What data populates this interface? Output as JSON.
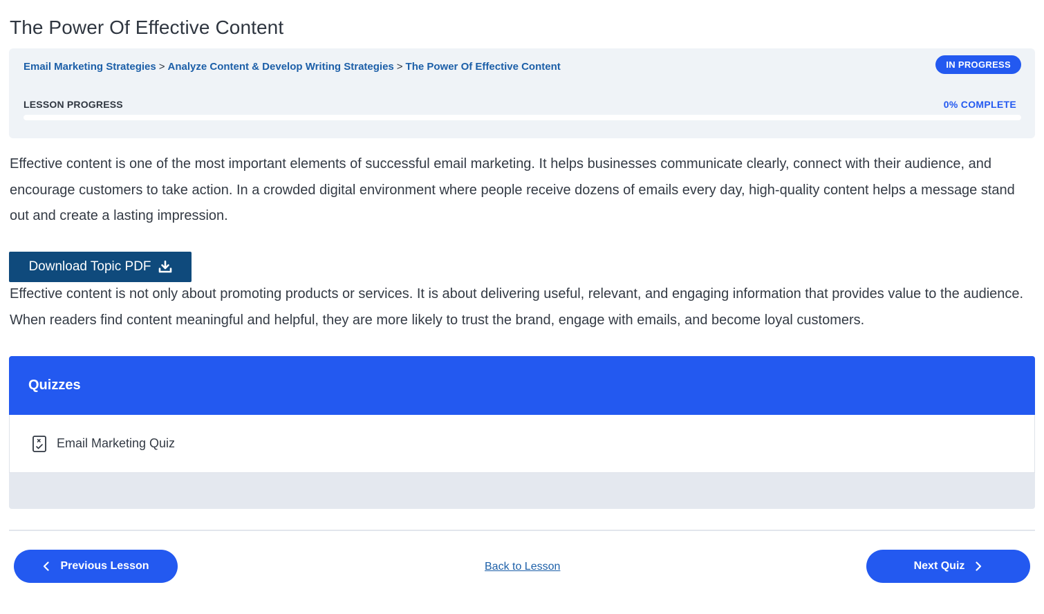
{
  "page": {
    "title": "The Power Of Effective Content"
  },
  "breadcrumb": {
    "items": [
      "Email Marketing Strategies",
      "Analyze Content & Develop Writing Strategies",
      "The Power Of Effective Content"
    ],
    "separator": ">"
  },
  "status": {
    "label": "IN PROGRESS"
  },
  "progress": {
    "label": "LESSON PROGRESS",
    "percent_text": "0% COMPLETE",
    "value": 0
  },
  "content": {
    "paragraph1": "Effective content is one of the most important elements of successful email marketing. It helps businesses communicate clearly, connect with their audience, and encourage customers to take action. In a crowded digital environment where people receive dozens of emails every day, high-quality content helps a message stand out and create a lasting impression.",
    "download_label": "Download Topic PDF",
    "paragraph2": "Effective content is not only about promoting products or services. It is about delivering useful, relevant, and engaging information that provides value to the audience. When readers find content meaningful and helpful, they are more likely to trust the brand, engage with emails, and become loyal customers."
  },
  "quizzes": {
    "heading": "Quizzes",
    "items": [
      {
        "label": "Email Marketing Quiz",
        "icon": "quiz-clipboard-icon"
      }
    ]
  },
  "navigation": {
    "previous_label": "Previous Lesson",
    "back_label": "Back to Lesson",
    "next_label": "Next Quiz"
  },
  "colors": {
    "accent": "#2359f0",
    "download_button": "#0f4a7c",
    "link": "#1c5fa8",
    "header_box": "#eff3f7"
  }
}
